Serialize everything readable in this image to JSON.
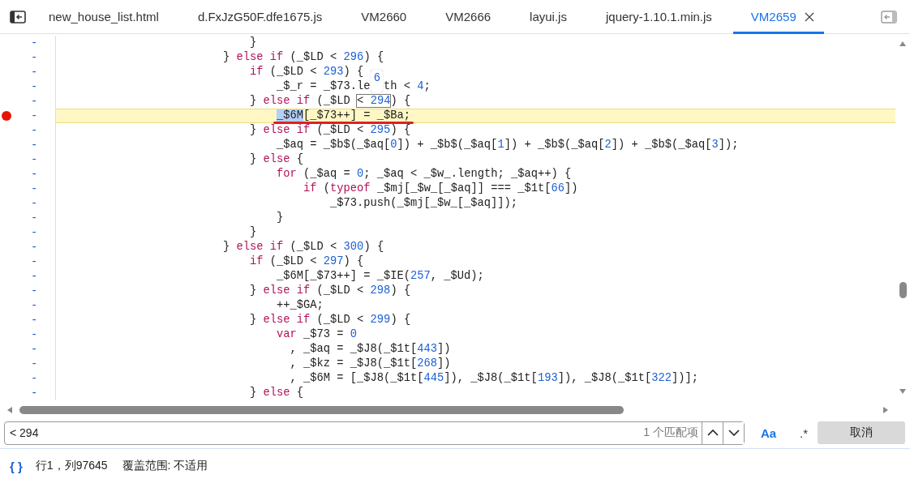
{
  "tabs": [
    {
      "label": "new_house_list.html",
      "selected": false
    },
    {
      "label": "d.FxJzG50F.dfe1675.js",
      "selected": false
    },
    {
      "label": "VM2660",
      "selected": false
    },
    {
      "label": "VM2666",
      "selected": false
    },
    {
      "label": "layui.js",
      "selected": false
    },
    {
      "label": "jquery-1.10.1.min.js",
      "selected": false
    },
    {
      "label": "VM2659",
      "selected": true
    }
  ],
  "editor": {
    "hover_tooltip": "6",
    "lines": [
      {
        "number": "-",
        "breakpoint": false,
        "highlighted": false,
        "underlined": false,
        "segments": [
          {
            "kind": "plain",
            "text": "                            }"
          }
        ]
      },
      {
        "number": "-",
        "breakpoint": false,
        "highlighted": false,
        "underlined": false,
        "segments": [
          {
            "kind": "plain",
            "text": "                        } "
          },
          {
            "kind": "keyword",
            "text": "else if"
          },
          {
            "kind": "plain",
            "text": " (_$LD < 296) {"
          }
        ]
      },
      {
        "number": "-",
        "breakpoint": false,
        "highlighted": false,
        "underlined": false,
        "segments": [
          {
            "kind": "keyword",
            "text": "                            if"
          },
          {
            "kind": "plain",
            "text": " (_$LD < 293) {"
          }
        ]
      },
      {
        "number": "-",
        "breakpoint": false,
        "highlighted": false,
        "underlined": false,
        "segments": [
          {
            "kind": "plain",
            "text": "                                _$_r = _$73.le  th < 4;"
          }
        ]
      },
      {
        "number": "-",
        "breakpoint": false,
        "highlighted": false,
        "underlined": false,
        "segments": [
          {
            "kind": "plain",
            "text": "                            } "
          },
          {
            "kind": "keyword",
            "text": "else if"
          },
          {
            "kind": "plain",
            "text": " (_$LD "
          },
          {
            "kind": "match",
            "text": "< 294"
          },
          {
            "kind": "plain",
            "text": ") {"
          }
        ]
      },
      {
        "number": "-",
        "breakpoint": true,
        "highlighted": true,
        "underlined": true,
        "segments": [
          {
            "kind": "selected",
            "text": "                                _$6M"
          },
          {
            "kind": "plain",
            "text": "[_$73++] = _$Ba;"
          }
        ]
      },
      {
        "number": "-",
        "breakpoint": false,
        "highlighted": false,
        "underlined": false,
        "segments": [
          {
            "kind": "plain",
            "text": "                            } "
          },
          {
            "kind": "keyword",
            "text": "else if"
          },
          {
            "kind": "plain",
            "text": " (_$LD < 295) {"
          }
        ]
      },
      {
        "number": "-",
        "breakpoint": false,
        "highlighted": false,
        "underlined": false,
        "segments": [
          {
            "kind": "plain",
            "text": "                                _$aq = _$b$(_$aq[0]) + _$b$(_$aq[1]) + _$b$(_$aq[2]) + _$b$(_$aq[3]);"
          }
        ]
      },
      {
        "number": "-",
        "breakpoint": false,
        "highlighted": false,
        "underlined": false,
        "segments": [
          {
            "kind": "plain",
            "text": "                            } "
          },
          {
            "kind": "keyword",
            "text": "else"
          },
          {
            "kind": "plain",
            "text": " {"
          }
        ]
      },
      {
        "number": "-",
        "breakpoint": false,
        "highlighted": false,
        "underlined": false,
        "segments": [
          {
            "kind": "keyword",
            "text": "                                for"
          },
          {
            "kind": "plain",
            "text": " (_$aq = 0; _$aq < _$w_.length; _$aq++) {"
          }
        ]
      },
      {
        "number": "-",
        "breakpoint": false,
        "highlighted": false,
        "underlined": false,
        "segments": [
          {
            "kind": "keyword",
            "text": "                                    if"
          },
          {
            "kind": "plain",
            "text": " ("
          },
          {
            "kind": "keyword",
            "text": "typeof"
          },
          {
            "kind": "plain",
            "text": " _$mj[_$w_[_$aq]] === _$1t[66])"
          }
        ]
      },
      {
        "number": "-",
        "breakpoint": false,
        "highlighted": false,
        "underlined": false,
        "segments": [
          {
            "kind": "plain",
            "text": "                                        _$73.push(_$mj[_$w_[_$aq]]);"
          }
        ]
      },
      {
        "number": "-",
        "breakpoint": false,
        "highlighted": false,
        "underlined": false,
        "segments": [
          {
            "kind": "plain",
            "text": "                                }"
          }
        ]
      },
      {
        "number": "-",
        "breakpoint": false,
        "highlighted": false,
        "underlined": false,
        "segments": [
          {
            "kind": "plain",
            "text": "                            }"
          }
        ]
      },
      {
        "number": "-",
        "breakpoint": false,
        "highlighted": false,
        "underlined": false,
        "segments": [
          {
            "kind": "plain",
            "text": "                        } "
          },
          {
            "kind": "keyword",
            "text": "else if"
          },
          {
            "kind": "plain",
            "text": " (_$LD < 300) {"
          }
        ]
      },
      {
        "number": "-",
        "breakpoint": false,
        "highlighted": false,
        "underlined": false,
        "segments": [
          {
            "kind": "keyword",
            "text": "                            if"
          },
          {
            "kind": "plain",
            "text": " (_$LD < 297) {"
          }
        ]
      },
      {
        "number": "-",
        "breakpoint": false,
        "highlighted": false,
        "underlined": false,
        "segments": [
          {
            "kind": "plain",
            "text": "                                _$6M[_$73++] = _$IE(257, _$Ud);"
          }
        ]
      },
      {
        "number": "-",
        "breakpoint": false,
        "highlighted": false,
        "underlined": false,
        "segments": [
          {
            "kind": "plain",
            "text": "                            } "
          },
          {
            "kind": "keyword",
            "text": "else if"
          },
          {
            "kind": "plain",
            "text": " (_$LD < 298) {"
          }
        ]
      },
      {
        "number": "-",
        "breakpoint": false,
        "highlighted": false,
        "underlined": false,
        "segments": [
          {
            "kind": "plain",
            "text": "                                ++_$GA;"
          }
        ]
      },
      {
        "number": "-",
        "breakpoint": false,
        "highlighted": false,
        "underlined": false,
        "segments": [
          {
            "kind": "plain",
            "text": "                            } "
          },
          {
            "kind": "keyword",
            "text": "else if"
          },
          {
            "kind": "plain",
            "text": " (_$LD < 299) {"
          }
        ]
      },
      {
        "number": "-",
        "breakpoint": false,
        "highlighted": false,
        "underlined": false,
        "segments": [
          {
            "kind": "keyword",
            "text": "                                var"
          },
          {
            "kind": "plain",
            "text": " _$73 = 0"
          }
        ]
      },
      {
        "number": "-",
        "breakpoint": false,
        "highlighted": false,
        "underlined": false,
        "segments": [
          {
            "kind": "plain",
            "text": "                                  , _$aq = _$J8(_$1t[443])"
          }
        ]
      },
      {
        "number": "-",
        "breakpoint": false,
        "highlighted": false,
        "underlined": false,
        "segments": [
          {
            "kind": "plain",
            "text": "                                  , _$kz = _$J8(_$1t[268])"
          }
        ]
      },
      {
        "number": "-",
        "breakpoint": false,
        "highlighted": false,
        "underlined": false,
        "segments": [
          {
            "kind": "plain",
            "text": "                                  , _$6M = [_$J8(_$1t[445]), _$J8(_$1t[193]), _$J8(_$1t[322])];"
          }
        ]
      },
      {
        "number": "-",
        "breakpoint": false,
        "highlighted": false,
        "underlined": false,
        "segments": [
          {
            "kind": "plain",
            "text": "                            } "
          },
          {
            "kind": "keyword",
            "text": "else"
          },
          {
            "kind": "plain",
            "text": " {"
          }
        ]
      }
    ]
  },
  "search": {
    "value": "< 294",
    "match_count": "1 个匹配项",
    "match_case": {
      "label": "Aa",
      "on": true
    },
    "regex": {
      "label": ".*",
      "on": false
    },
    "cancel": "取消"
  },
  "status_bar": {
    "braces": "{ }",
    "position": "行1，列97645",
    "coverage": "覆盖范围: 不适用"
  }
}
